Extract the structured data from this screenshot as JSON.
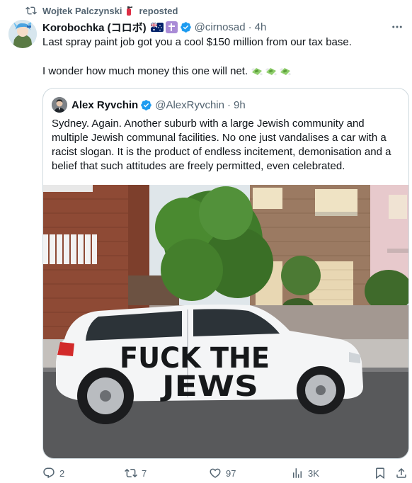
{
  "repost": {
    "user": "Wojtek Palczynski",
    "label": "reposted"
  },
  "tweet": {
    "author_name": "Korobochka (コロボ)",
    "handle": "@cirnosad",
    "separator": "·",
    "time": "4h",
    "text_line1": "Last spray paint job got you a cool $150 million from our tax base.",
    "text_line2": "I wonder how much money this one will net.",
    "emoji": "money-with-wings"
  },
  "quote": {
    "author_name": "Alex Ryvchin",
    "handle": "@AlexRyvchin",
    "separator": "·",
    "time": "9h",
    "text": "Sydney. Again. Another suburb with a large Jewish community and multiple Jewish communal facilities. No one just vandalises a car with a racist slogan. It is the product of endless incitement, demonisation and a belief that such attitudes are freely permitted, even celebrated.",
    "graffiti_line1": "FUCK THE",
    "graffiti_line2": "JEWS"
  },
  "actions": {
    "replies": "2",
    "reposts": "7",
    "likes": "97",
    "views": "3K"
  },
  "colors": {
    "text": "#0f1419",
    "secondary": "#536471",
    "verified": "#1d9bf0",
    "border": "#cfd9de",
    "repost_active": "#536471"
  }
}
